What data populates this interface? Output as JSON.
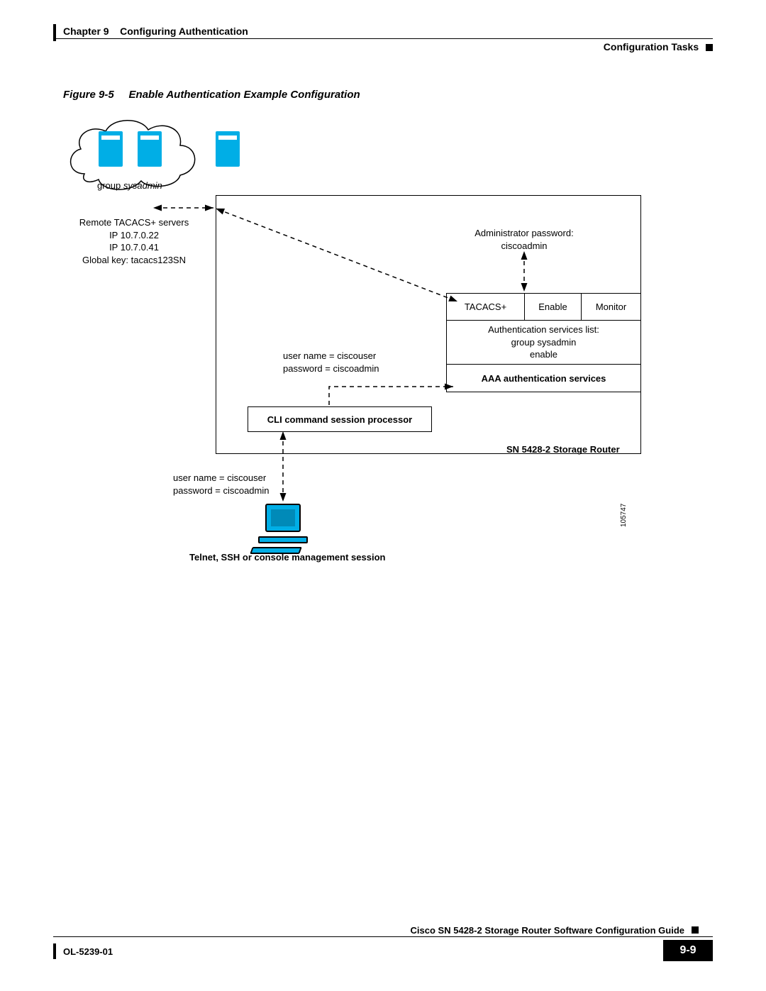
{
  "header": {
    "chapter_label": "Chapter 9",
    "chapter_title": "Configuring Authentication",
    "section": "Configuration Tasks"
  },
  "figure": {
    "number": "Figure 9-5",
    "title": "Enable Authentication Example Configuration"
  },
  "cloud": {
    "group_word": "group",
    "group_name": "sysadmin",
    "remote_line1": "Remote TACACS+ servers",
    "remote_line2": "IP 10.7.0.22",
    "remote_line3": "IP 10.7.0.41",
    "remote_line4": "Global key: tacacs123SN"
  },
  "admin": {
    "line1": "Administrator password:",
    "line2": "ciscoadmin"
  },
  "aaa": {
    "col1": "TACACS+",
    "col2": "Enable",
    "col3": "Monitor",
    "list_line1": "Authentication services list:",
    "list_line2": "group sysadmin",
    "list_line3": "enable",
    "title": "AAA authentication services"
  },
  "router_label": "SN 5428-2 Storage Router",
  "cli_box": "CLI command session processor",
  "creds1": {
    "line1": "user name =  ciscouser",
    "line2": "password   = ciscoadmin"
  },
  "creds2": {
    "line1": "user name = ciscouser",
    "line2": "password = ciscoadmin"
  },
  "session_label": "Telnet, SSH or console management session",
  "diagram_id": "105747",
  "footer": {
    "guide": "Cisco SN 5428-2 Storage Router Software Configuration Guide",
    "docnum": "OL-5239-01",
    "pagenum": "9-9"
  }
}
